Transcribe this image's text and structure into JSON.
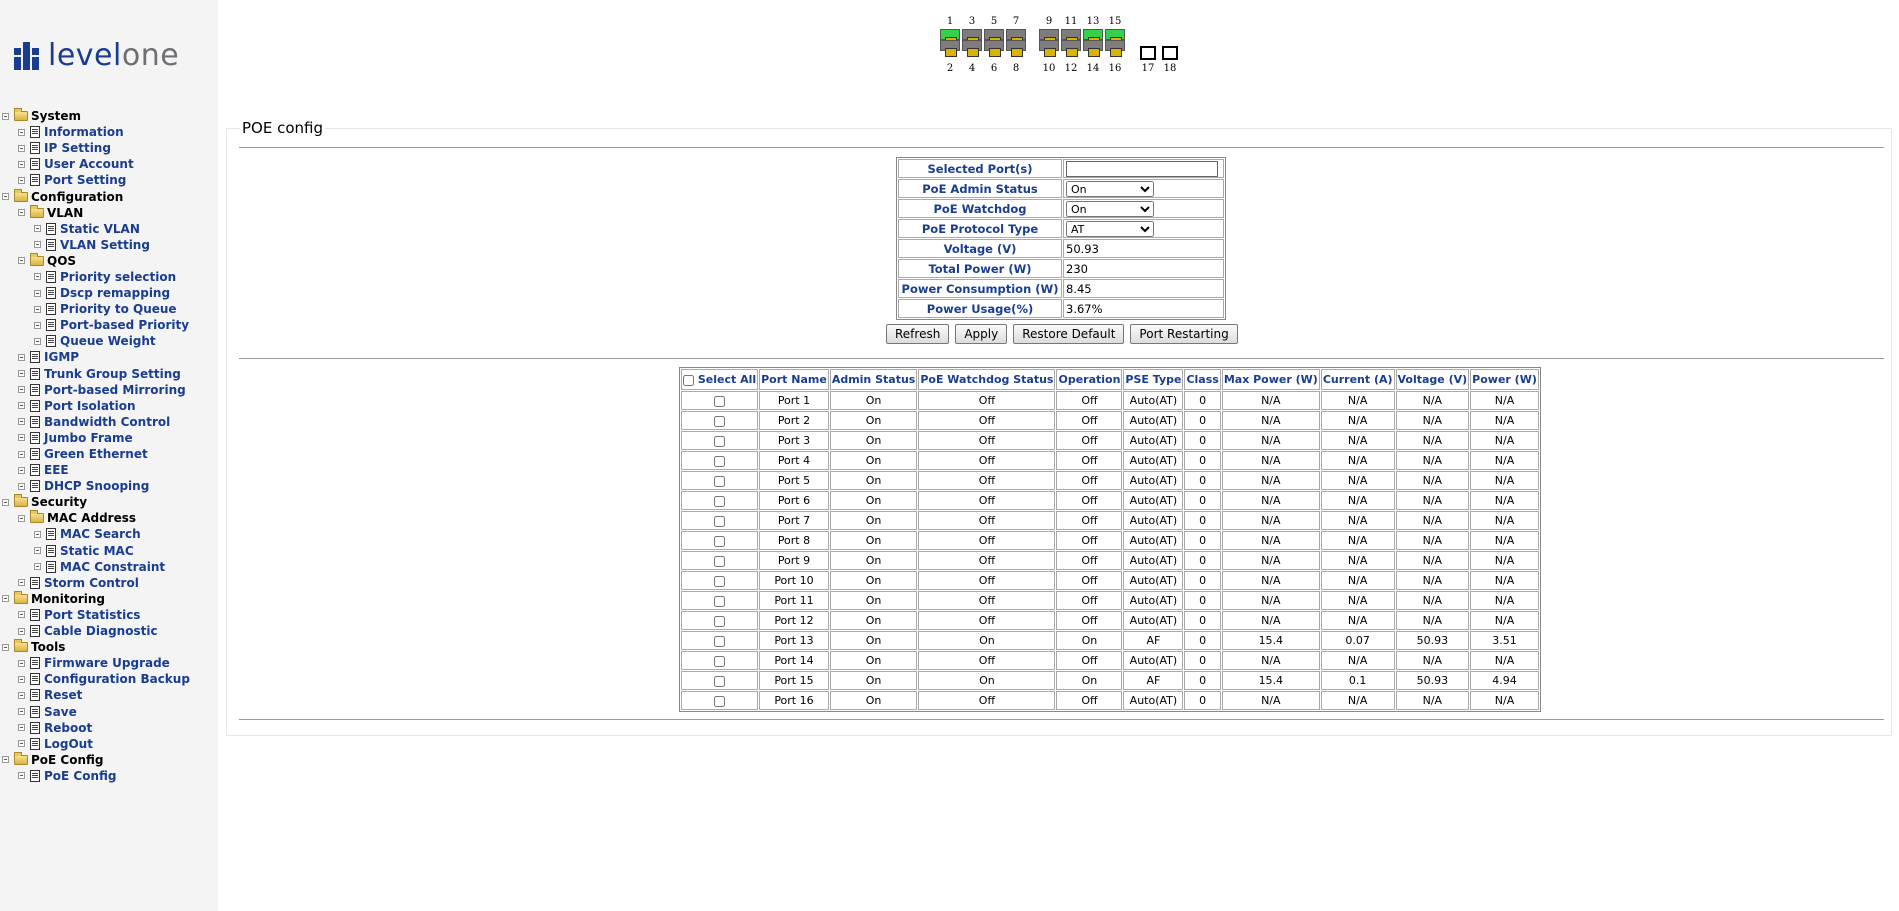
{
  "brand": {
    "logo_text_a": "level",
    "logo_text_b": "one",
    "brand_color": "#1a3d8f"
  },
  "nav": [
    {
      "label": "System",
      "type": "folder",
      "level": 0
    },
    {
      "label": "Information",
      "type": "page",
      "level": 1
    },
    {
      "label": "IP Setting",
      "type": "page",
      "level": 1
    },
    {
      "label": "User Account",
      "type": "page",
      "level": 1
    },
    {
      "label": "Port Setting",
      "type": "page",
      "level": 1
    },
    {
      "label": "Configuration",
      "type": "folder",
      "level": 0
    },
    {
      "label": "VLAN",
      "type": "folder",
      "level": 1
    },
    {
      "label": "Static VLAN",
      "type": "page",
      "level": 2
    },
    {
      "label": "VLAN Setting",
      "type": "page",
      "level": 2
    },
    {
      "label": "QOS",
      "type": "folder",
      "level": 1
    },
    {
      "label": "Priority selection",
      "type": "page",
      "level": 2
    },
    {
      "label": "Dscp remapping",
      "type": "page",
      "level": 2
    },
    {
      "label": "Priority to Queue",
      "type": "page",
      "level": 2
    },
    {
      "label": "Port-based Priority",
      "type": "page",
      "level": 2
    },
    {
      "label": "Queue Weight",
      "type": "page",
      "level": 2
    },
    {
      "label": "IGMP",
      "type": "page",
      "level": 1
    },
    {
      "label": "Trunk Group Setting",
      "type": "page",
      "level": 1
    },
    {
      "label": "Port-based Mirroring",
      "type": "page",
      "level": 1
    },
    {
      "label": "Port Isolation",
      "type": "page",
      "level": 1
    },
    {
      "label": "Bandwidth Control",
      "type": "page",
      "level": 1
    },
    {
      "label": "Jumbo Frame",
      "type": "page",
      "level": 1
    },
    {
      "label": "Green Ethernet",
      "type": "page",
      "level": 1
    },
    {
      "label": "EEE",
      "type": "page",
      "level": 1
    },
    {
      "label": "DHCP Snooping",
      "type": "page",
      "level": 1
    },
    {
      "label": "Security",
      "type": "folder",
      "level": 0
    },
    {
      "label": "MAC Address",
      "type": "folder",
      "level": 1
    },
    {
      "label": "MAC Search",
      "type": "page",
      "level": 2
    },
    {
      "label": "Static MAC",
      "type": "page",
      "level": 2
    },
    {
      "label": "MAC Constraint",
      "type": "page",
      "level": 2
    },
    {
      "label": "Storm Control",
      "type": "page",
      "level": 1
    },
    {
      "label": "Monitoring",
      "type": "folder",
      "level": 0
    },
    {
      "label": "Port Statistics",
      "type": "page",
      "level": 1
    },
    {
      "label": "Cable Diagnostic",
      "type": "page",
      "level": 1
    },
    {
      "label": "Tools",
      "type": "folder",
      "level": 0
    },
    {
      "label": "Firmware Upgrade",
      "type": "page",
      "level": 1
    },
    {
      "label": "Configuration Backup",
      "type": "page",
      "level": 1
    },
    {
      "label": "Reset",
      "type": "page",
      "level": 1
    },
    {
      "label": "Save",
      "type": "page",
      "level": 1
    },
    {
      "label": "Reboot",
      "type": "page",
      "level": 1
    },
    {
      "label": "LogOut",
      "type": "page",
      "level": 1
    },
    {
      "label": "PoE Config",
      "type": "folder",
      "level": 0
    },
    {
      "label": "PoE Config",
      "type": "page",
      "level": 1
    }
  ],
  "device": {
    "top_numbers": [
      "1",
      "3",
      "5",
      "7",
      "9",
      "11",
      "13",
      "15"
    ],
    "bottom_numbers": [
      "2",
      "4",
      "6",
      "8",
      "10",
      "12",
      "14",
      "16"
    ],
    "sfp_numbers": [
      "17",
      "18"
    ],
    "active_ports": [
      1,
      13,
      15
    ],
    "active_color": "#33d24b"
  },
  "page": {
    "title": "POE config"
  },
  "config": {
    "rows": [
      {
        "label": "Selected Port(s)",
        "kind": "text",
        "value": ""
      },
      {
        "label": "PoE Admin Status",
        "kind": "select",
        "value": "On"
      },
      {
        "label": "PoE Watchdog",
        "kind": "select",
        "value": "On"
      },
      {
        "label": "PoE Protocol Type",
        "kind": "select",
        "value": "AT"
      },
      {
        "label": "Voltage (V)",
        "kind": "static",
        "value": "50.93"
      },
      {
        "label": "Total Power (W)",
        "kind": "static",
        "value": "230"
      },
      {
        "label": "Power Consumption (W)",
        "kind": "static",
        "value": "8.45"
      },
      {
        "label": "Power Usage(%)",
        "kind": "static",
        "value": "3.67%"
      }
    ]
  },
  "buttons": {
    "refresh": "Refresh",
    "apply": "Apply",
    "restore": "Restore Default",
    "restart": "Port Restarting"
  },
  "ports_table": {
    "select_all": "Select All",
    "headers": [
      "Port Name",
      "Admin Status",
      "PoE Watchdog Status",
      "Operation",
      "PSE Type",
      "Class",
      "Max Power (W)",
      "Current (A)",
      "Voltage (V)",
      "Power (W)"
    ],
    "rows": [
      [
        "Port 1",
        "On",
        "Off",
        "Off",
        "Auto(AT)",
        "0",
        "N/A",
        "N/A",
        "N/A",
        "N/A"
      ],
      [
        "Port 2",
        "On",
        "Off",
        "Off",
        "Auto(AT)",
        "0",
        "N/A",
        "N/A",
        "N/A",
        "N/A"
      ],
      [
        "Port 3",
        "On",
        "Off",
        "Off",
        "Auto(AT)",
        "0",
        "N/A",
        "N/A",
        "N/A",
        "N/A"
      ],
      [
        "Port 4",
        "On",
        "Off",
        "Off",
        "Auto(AT)",
        "0",
        "N/A",
        "N/A",
        "N/A",
        "N/A"
      ],
      [
        "Port 5",
        "On",
        "Off",
        "Off",
        "Auto(AT)",
        "0",
        "N/A",
        "N/A",
        "N/A",
        "N/A"
      ],
      [
        "Port 6",
        "On",
        "Off",
        "Off",
        "Auto(AT)",
        "0",
        "N/A",
        "N/A",
        "N/A",
        "N/A"
      ],
      [
        "Port 7",
        "On",
        "Off",
        "Off",
        "Auto(AT)",
        "0",
        "N/A",
        "N/A",
        "N/A",
        "N/A"
      ],
      [
        "Port 8",
        "On",
        "Off",
        "Off",
        "Auto(AT)",
        "0",
        "N/A",
        "N/A",
        "N/A",
        "N/A"
      ],
      [
        "Port 9",
        "On",
        "Off",
        "Off",
        "Auto(AT)",
        "0",
        "N/A",
        "N/A",
        "N/A",
        "N/A"
      ],
      [
        "Port 10",
        "On",
        "Off",
        "Off",
        "Auto(AT)",
        "0",
        "N/A",
        "N/A",
        "N/A",
        "N/A"
      ],
      [
        "Port 11",
        "On",
        "Off",
        "Off",
        "Auto(AT)",
        "0",
        "N/A",
        "N/A",
        "N/A",
        "N/A"
      ],
      [
        "Port 12",
        "On",
        "Off",
        "Off",
        "Auto(AT)",
        "0",
        "N/A",
        "N/A",
        "N/A",
        "N/A"
      ],
      [
        "Port 13",
        "On",
        "On",
        "On",
        "AF",
        "0",
        "15.4",
        "0.07",
        "50.93",
        "3.51"
      ],
      [
        "Port 14",
        "On",
        "Off",
        "Off",
        "Auto(AT)",
        "0",
        "N/A",
        "N/A",
        "N/A",
        "N/A"
      ],
      [
        "Port 15",
        "On",
        "On",
        "On",
        "AF",
        "0",
        "15.4",
        "0.1",
        "50.93",
        "4.94"
      ],
      [
        "Port 16",
        "On",
        "Off",
        "Off",
        "Auto(AT)",
        "0",
        "N/A",
        "N/A",
        "N/A",
        "N/A"
      ]
    ]
  }
}
